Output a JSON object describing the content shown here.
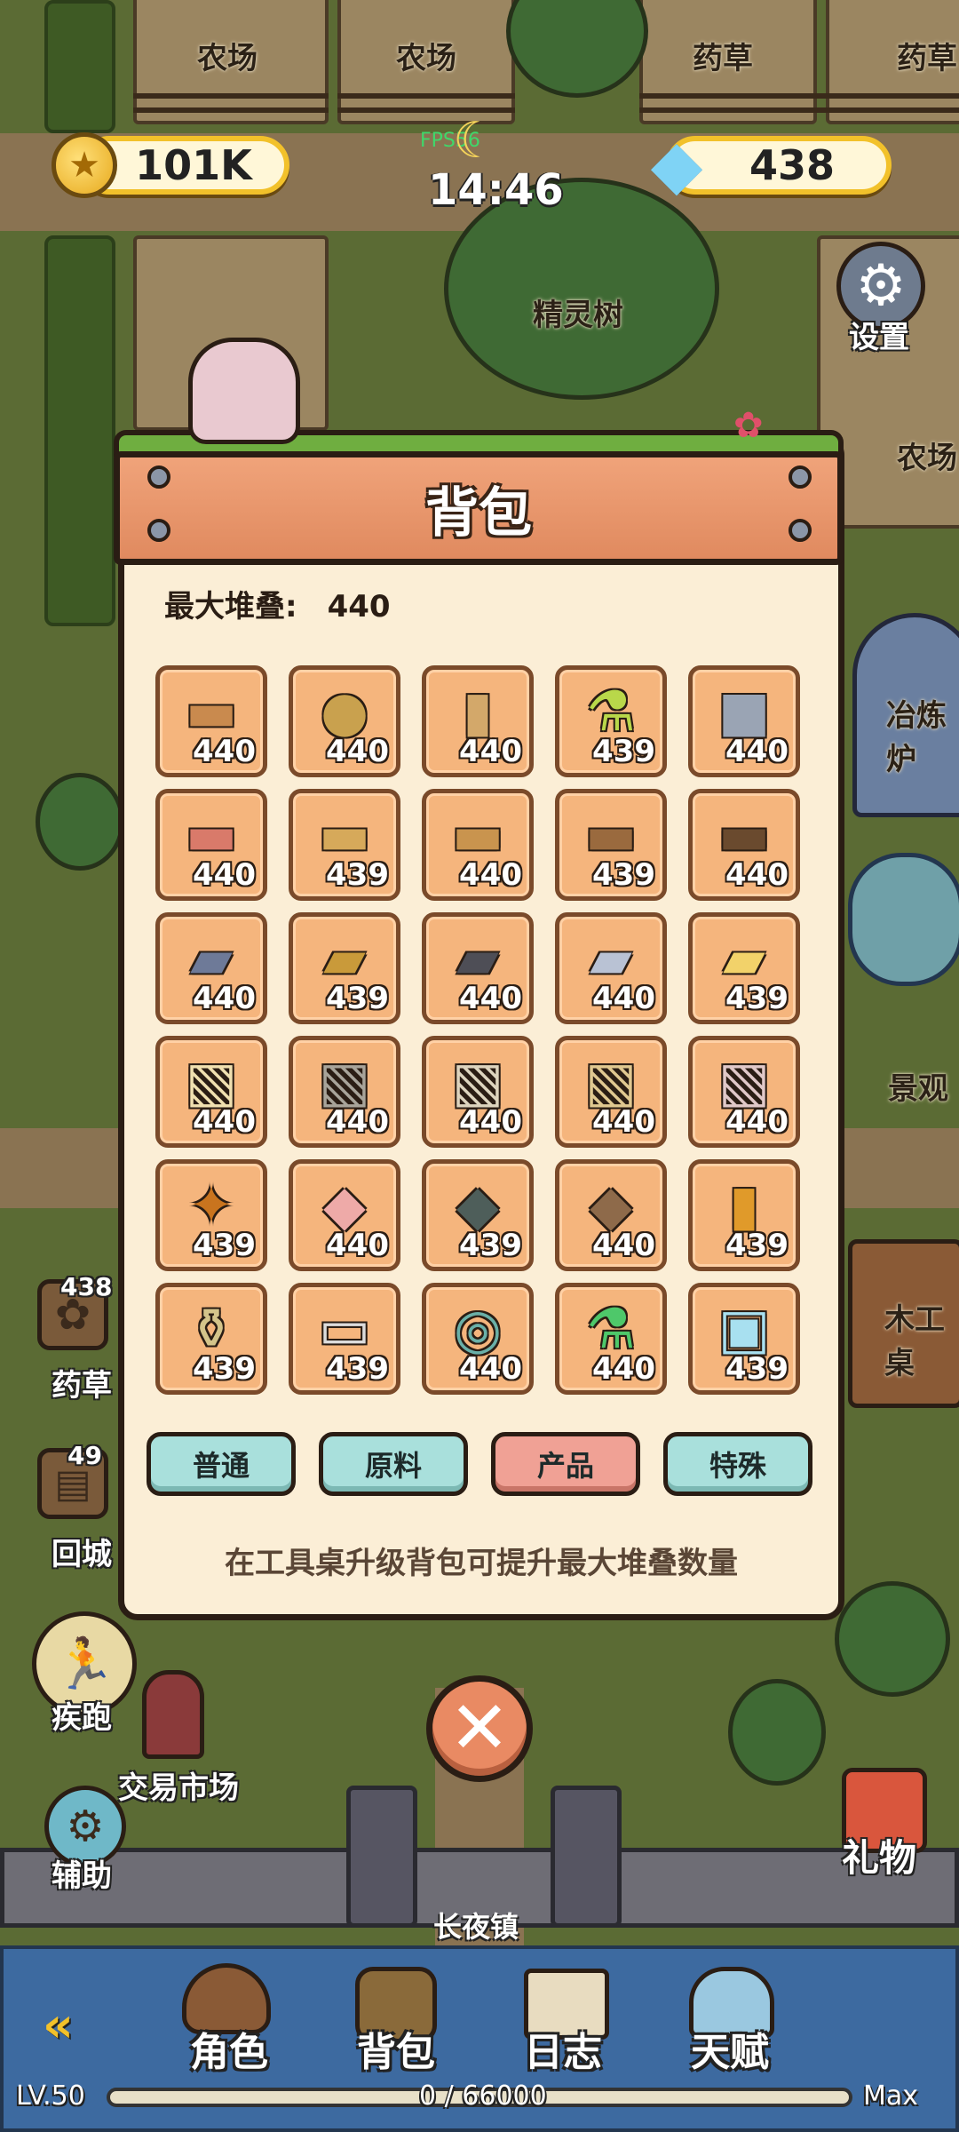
{
  "hud": {
    "coins": "101K",
    "gems": "438",
    "time": "14:46",
    "fps": "FPS56",
    "settings_label": "设置"
  },
  "world_labels": {
    "farm1": "农场",
    "farm2": "农场",
    "herb1": "药草",
    "herb2": "药草",
    "spirit_tree": "精灵树",
    "farm3": "农场",
    "smelter": "冶炼炉",
    "scenery": "景观",
    "workbench": "木工桌",
    "trade_market": "交易市场",
    "town": "长夜镇"
  },
  "modal": {
    "title": "背包",
    "max_stack_label": "最大堆叠:",
    "max_stack_value": "440",
    "hint": "在工具桌升级背包可提升最大堆叠数量",
    "tabs": [
      {
        "label": "普通",
        "active": false
      },
      {
        "label": "原料",
        "active": false
      },
      {
        "label": "产品",
        "active": true
      },
      {
        "label": "特殊",
        "active": false
      }
    ],
    "items": [
      {
        "icon": "wood-plank-icon",
        "count": "440"
      },
      {
        "icon": "yarn-ball-icon",
        "count": "440"
      },
      {
        "icon": "scroll-icon",
        "count": "440"
      },
      {
        "icon": "potion-flask-icon",
        "count": "439"
      },
      {
        "icon": "iron-cube-icon",
        "count": "440"
      },
      {
        "icon": "blossom-plank-icon",
        "count": "440"
      },
      {
        "icon": "sprout-plank-icon",
        "count": "439"
      },
      {
        "icon": "seedling-plank-icon",
        "count": "440"
      },
      {
        "icon": "leaf-plank-icon",
        "count": "439"
      },
      {
        "icon": "dark-sprout-plank-icon",
        "count": "440"
      },
      {
        "icon": "steel-ingot-icon",
        "count": "440"
      },
      {
        "icon": "bronze-ingot-icon",
        "count": "439"
      },
      {
        "icon": "dark-ingot-icon",
        "count": "440"
      },
      {
        "icon": "silver-ingot-icon",
        "count": "440"
      },
      {
        "icon": "gold-ingot-icon",
        "count": "439"
      },
      {
        "icon": "gold-cloth-icon",
        "count": "440"
      },
      {
        "icon": "grey-cloth-icon",
        "count": "440"
      },
      {
        "icon": "linen-cloth-icon",
        "count": "440"
      },
      {
        "icon": "tan-cloth-icon",
        "count": "440"
      },
      {
        "icon": "red-cloth-icon",
        "count": "440"
      },
      {
        "icon": "sparkle-hide-icon",
        "count": "439"
      },
      {
        "icon": "pink-hide-icon",
        "count": "440"
      },
      {
        "icon": "dark-fur-icon",
        "count": "439"
      },
      {
        "icon": "brown-fur-icon",
        "count": "440"
      },
      {
        "icon": "orange-scroll-icon",
        "count": "439"
      },
      {
        "icon": "seed-jar-icon",
        "count": "439"
      },
      {
        "icon": "silver-bar-icon",
        "count": "439"
      },
      {
        "icon": "compass-icon",
        "count": "440"
      },
      {
        "icon": "green-potion-icon",
        "count": "440"
      },
      {
        "icon": "glass-pane-icon",
        "count": "439"
      }
    ]
  },
  "side": {
    "herb_count": "438",
    "herb_label": "药草",
    "return_count": "49",
    "return_label": "回城",
    "sprint_label": "疾跑",
    "assist_label": "辅助",
    "gift_label": "礼物"
  },
  "bottom_nav": {
    "items": [
      {
        "label": "角色",
        "icon": "character-icon"
      },
      {
        "label": "背包",
        "icon": "backpack-icon"
      },
      {
        "label": "日志",
        "icon": "journal-icon"
      },
      {
        "label": "天赋",
        "icon": "talent-icon"
      }
    ],
    "level": "LV.50",
    "xp": "0 / 66000",
    "xp_fraction": 0,
    "max_label": "Max"
  }
}
